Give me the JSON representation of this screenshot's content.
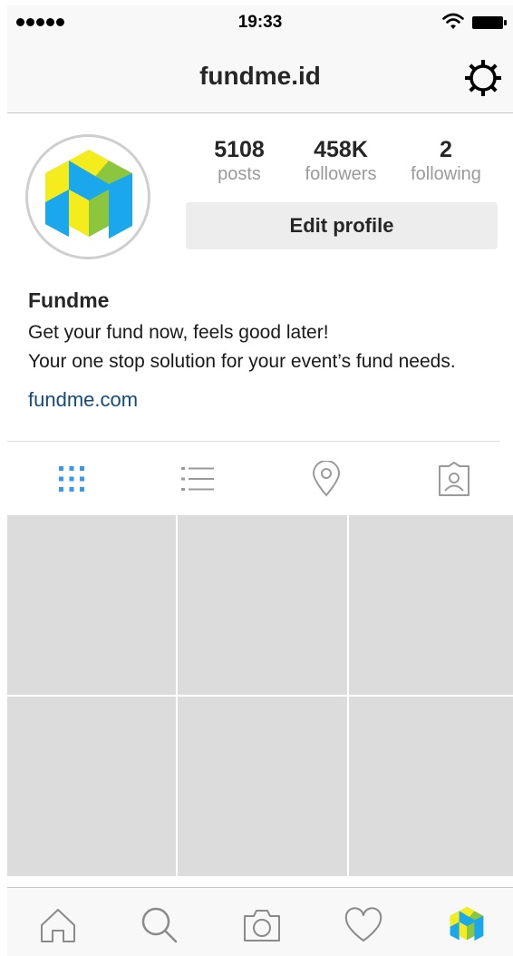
{
  "status_bar": {
    "time": "19:33"
  },
  "header": {
    "title": "fundme.id"
  },
  "profile": {
    "stats": {
      "posts": {
        "value": "5108",
        "label": "posts"
      },
      "followers": {
        "value": "458K",
        "label": "followers"
      },
      "following": {
        "value": "2",
        "label": "following"
      }
    },
    "edit_button_label": "Edit profile",
    "name": "Fundme",
    "bio_line1": "Get your fund now, feels good later!",
    "bio_line2": "Your one stop solution for your event’s fund needs.",
    "website": "fundme.com"
  },
  "tabs": [
    {
      "icon": "grid-icon",
      "active": true
    },
    {
      "icon": "list-icon",
      "active": false
    },
    {
      "icon": "location-pin-icon",
      "active": false
    },
    {
      "icon": "tagged-person-icon",
      "active": false
    }
  ],
  "posts_grid": {
    "rows": 2,
    "columns": 3
  },
  "bottom_nav": [
    {
      "icon": "home-icon"
    },
    {
      "icon": "search-icon"
    },
    {
      "icon": "camera-icon"
    },
    {
      "icon": "heart-icon"
    },
    {
      "icon": "profile-avatar-icon"
    }
  ],
  "colors": {
    "accent_blue": "#3897f0",
    "link": "#134a7c",
    "logo_blue": "#1aa7ec",
    "logo_yellow": "#f5ec1e",
    "logo_green": "#8cc63f",
    "placeholder": "#dcdcdc"
  }
}
